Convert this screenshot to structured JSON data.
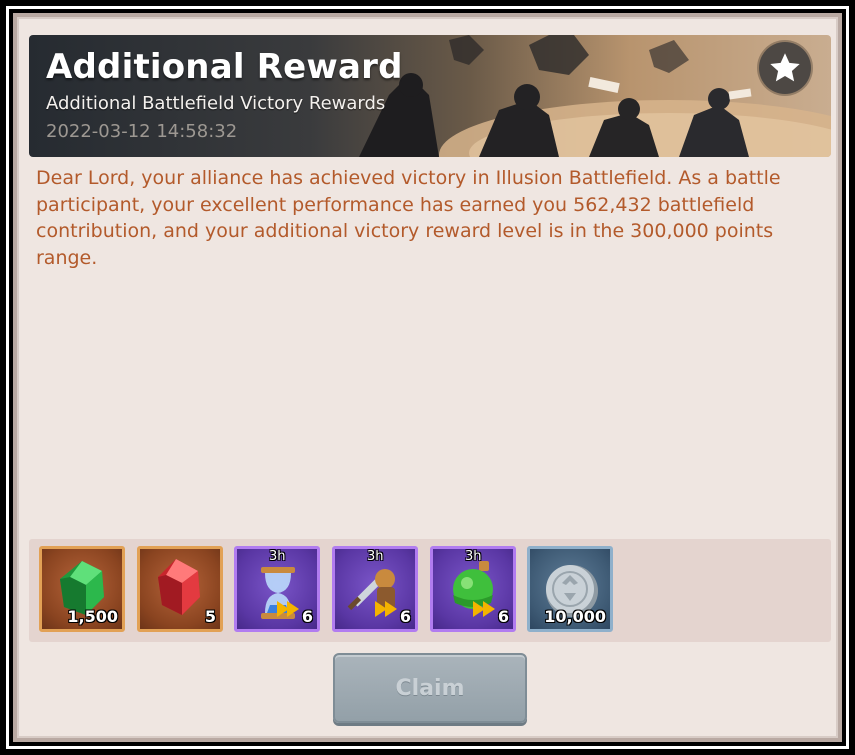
{
  "mail": {
    "title": "Additional Reward",
    "subtitle": "Additional Battlefield Victory Rewards",
    "timestamp": "2022-03-12 14:58:32",
    "body": "Dear Lord, your alliance has achieved victory in Illusion Battlefield. As a battle participant, your excellent performance has earned you 562,432 battlefield contribution, and your additional victory reward level is in the 300,000 points range."
  },
  "rewards": [
    {
      "icon": "emerald-gem-icon",
      "quantity": "1,500",
      "frame": "orange"
    },
    {
      "icon": "ruby-gem-icon",
      "quantity": "5",
      "frame": "orange"
    },
    {
      "icon": "hourglass-speedup-icon",
      "quantity": "6",
      "duration": "3h",
      "frame": "purple"
    },
    {
      "icon": "sword-warrior-speedup-icon",
      "quantity": "6",
      "duration": "3h",
      "frame": "purple"
    },
    {
      "icon": "potion-speedup-icon",
      "quantity": "6",
      "duration": "3h",
      "frame": "purple"
    },
    {
      "icon": "silver-coin-icon",
      "quantity": "10,000",
      "frame": "blue"
    }
  ],
  "actions": {
    "claim_label": "Claim",
    "favorite_icon": "star-icon"
  },
  "colors": {
    "panel_bg": "#efe6e1",
    "message_text": "#b35a2b",
    "frame_orange": "#e2a155",
    "frame_purple": "#b17cf0",
    "frame_blue": "#8fb0cb",
    "claim_button_disabled": "#9aa6ae"
  }
}
